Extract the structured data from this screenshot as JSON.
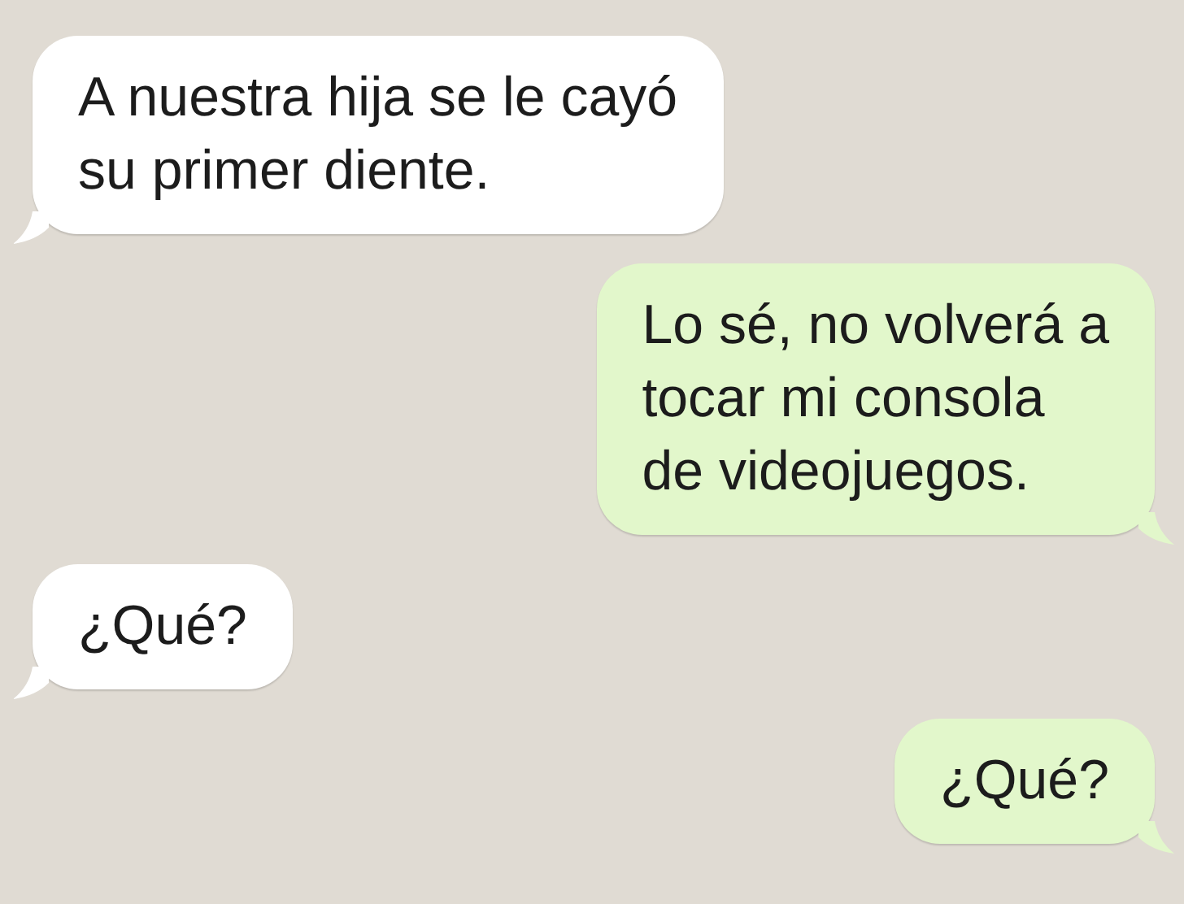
{
  "messages": [
    {
      "kind": "incoming",
      "text": "A nuestra hija se le cayó\nsu primer diente."
    },
    {
      "kind": "outgoing",
      "text": "Lo sé, no volverá a\ntocar mi consola\nde videojuegos."
    },
    {
      "kind": "incoming",
      "text": "¿Qué?"
    },
    {
      "kind": "outgoing",
      "text": "¿Qué?"
    }
  ]
}
